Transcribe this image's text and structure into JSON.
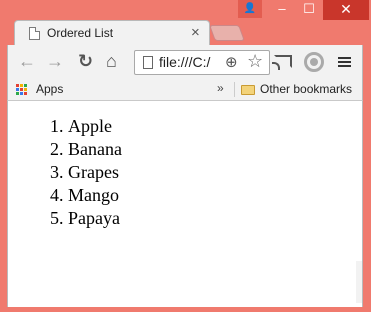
{
  "window": {
    "controls": {
      "minimize": "–",
      "maximize": "☐",
      "close": "✕"
    }
  },
  "tab": {
    "title": "Ordered List",
    "close": "×"
  },
  "toolbar": {
    "back": "←",
    "forward": "→",
    "reload": "↻",
    "home": "⌂",
    "url": "file:///C:/",
    "zoom": "⊕",
    "star": "☆"
  },
  "bookmarks": {
    "apps_label": "Apps",
    "overflow": "»",
    "other_label": "Other bookmarks"
  },
  "content": {
    "list_items": [
      "Apple",
      "Banana",
      "Grapes",
      "Mango",
      "Papaya"
    ]
  },
  "colors": {
    "window_frame": "#f07a6e",
    "close_button": "#c9362b",
    "chrome_bg": "#f2f2f2"
  }
}
